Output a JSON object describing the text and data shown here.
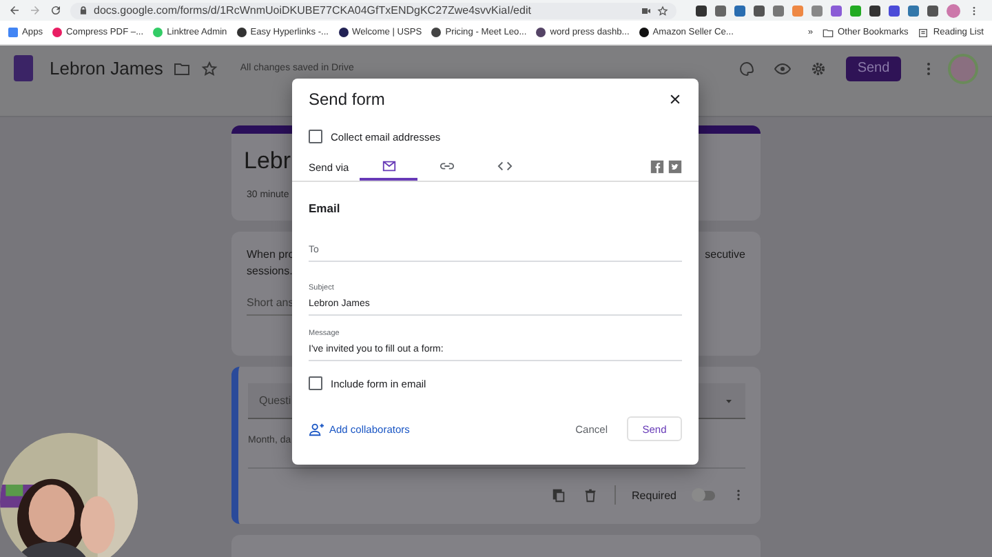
{
  "browser": {
    "url": "docs.google.com/forms/d/1RcWnmUoiDKUBE77CKA04GfTxENDgKC27Zwe4svvKiaI/edit",
    "bookmarks": [
      {
        "label": "Apps"
      },
      {
        "label": "Compress PDF –..."
      },
      {
        "label": "Linktree Admin"
      },
      {
        "label": "Easy Hyperlinks -..."
      },
      {
        "label": "Welcome | USPS"
      },
      {
        "label": "Pricing - Meet Leo..."
      },
      {
        "label": "word press dashb..."
      },
      {
        "label": "Amazon Seller Ce..."
      }
    ],
    "overflow": "»",
    "other_bookmarks": "Other Bookmarks",
    "reading_list": "Reading List"
  },
  "app_header": {
    "title": "Lebron James",
    "save_status": "All changes saved in Drive",
    "send_button": "Send"
  },
  "form": {
    "title": "Lebr",
    "subtitle": "30 minute",
    "question_1": {
      "text_left": "When pro",
      "text_right": "secutive",
      "text_line2": "sessions.",
      "answer_placeholder": "Short ans"
    },
    "question_2": {
      "title_placeholder": "Questi",
      "answer_hint": "Month, da",
      "required_label": "Required",
      "required": false
    }
  },
  "dialog": {
    "title": "Send form",
    "collect_email": {
      "label": "Collect email addresses",
      "checked": false
    },
    "send_via_label": "Send via",
    "tabs": [
      {
        "kind": "email",
        "selected": true
      },
      {
        "kind": "link",
        "selected": false
      },
      {
        "kind": "embed",
        "selected": false
      }
    ],
    "section_title": "Email",
    "to": {
      "placeholder": "To"
    },
    "subject": {
      "label": "Subject",
      "value": "Lebron James"
    },
    "message": {
      "label": "Message",
      "value": "I've invited you to fill out a form:"
    },
    "include_form": {
      "label": "Include form in email",
      "checked": false
    },
    "add_collaborators": "Add collaborators",
    "cancel": "Cancel",
    "send": "Send"
  }
}
